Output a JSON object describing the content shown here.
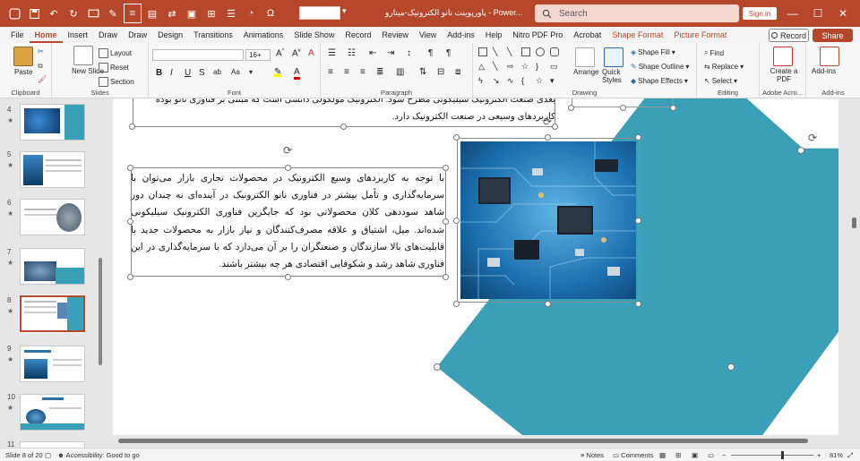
{
  "titlebar": {
    "doc_title": "پاورپوینت نانو الکترونیک-مینارو  -  Power...",
    "search_placeholder": "Search",
    "signin": "Sign in"
  },
  "tabs": [
    "File",
    "Home",
    "Insert",
    "Draw",
    "Draw",
    "Design",
    "Transitions",
    "Animations",
    "Slide Show",
    "Record",
    "Review",
    "View",
    "Add-ins",
    "Help",
    "Nitro PDF Pro",
    "Acrobat",
    "Shape Format",
    "Picture Format"
  ],
  "record_label": "Record",
  "share_label": "Share",
  "ribbon": {
    "clipboard": {
      "label": "Clipboard",
      "paste": "Paste"
    },
    "slides": {
      "label": "Slides",
      "new_slide": "New Slide",
      "layout": "Layout",
      "reset": "Reset",
      "section": "Section"
    },
    "font": {
      "label": "Font",
      "size": "16+",
      "bold": "B",
      "italic": "I",
      "underline": "U",
      "strike": "S"
    },
    "paragraph": {
      "label": "Paragraph"
    },
    "drawing": {
      "label": "Drawing",
      "arrange": "Arrange",
      "quick_styles": "Quick Styles",
      "shape_fill": "Shape Fill",
      "shape_outline": "Shape Outline",
      "shape_effects": "Shape Effects"
    },
    "editing": {
      "label": "Editing",
      "find": "Find",
      "replace": "Replace",
      "select": "Select"
    },
    "adobe": {
      "label": "Adobe Acro...",
      "create_pdf": "Create a PDF"
    },
    "addins": {
      "label": "Add-ins",
      "addins": "Add-ins"
    }
  },
  "thumbnails": [
    {
      "num": "4",
      "star": "★"
    },
    {
      "num": "5",
      "star": "★"
    },
    {
      "num": "6",
      "star": "★"
    },
    {
      "num": "7",
      "star": "★"
    },
    {
      "num": "8",
      "star": "★"
    },
    {
      "num": "9",
      "star": "★"
    },
    {
      "num": "10",
      "star": "★"
    },
    {
      "num": "11",
      "star": ""
    }
  ],
  "slide": {
    "top_text_line1": "بعدی صنعت الکترونیک سیلیکونی مطرح شود. الکترونیک مولکولی دانشی است که مبتنی بر فناوری نانو بوده",
    "top_text_line2": "کاربردهای وسیعی در صنعت الکترونیک دارد.",
    "body_text": "با توجه به کاربردهای وسیع الکترونیک در محصولات تجاری بازار می‌توان با سرمایه‌گذاری و تأمل بیشتر در فناوری نانو الکترونیک در آینده‌ای نه چندان دور شاهد سوددهی کلان محصولاتی بود که جایگزین فناوری الکترونیک سیلیکونی شده‌اند. میل، اشتیاق و علاقه مصرف‌کنندگان و نیاز بازار به محصولات جدید با قابلیت‌های بالا سازندگان و صنعتگران را بر آن می‌دارد که با سرمایه‌گذاری در این فناوری شاهد رشد و شکوفایی اقتصادی هر چه بیشتر باشند."
  },
  "status": {
    "slide_info": "Slide 8 of 20",
    "accessibility": "Accessibility: Good to go",
    "notes": "Notes",
    "comments": "Comments",
    "zoom": "81%"
  },
  "colors": {
    "accent": "#b7472a",
    "teal": "#3aa0b7"
  }
}
